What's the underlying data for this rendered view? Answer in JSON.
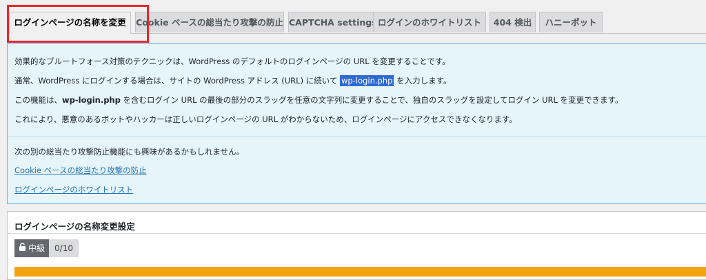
{
  "tabs": [
    {
      "label": "ログインページの名称を変更",
      "active": true
    },
    {
      "label": "Cookie ベースの総当たり攻撃の防止",
      "active": false
    },
    {
      "label": "CAPTCHA settings",
      "active": false
    },
    {
      "label": "ログインのホワイトリスト",
      "active": false
    },
    {
      "label": "404 検出",
      "active": false
    },
    {
      "label": "ハニーポット",
      "active": false
    }
  ],
  "info": {
    "line1": "効果的なブルートフォース対策のテクニックは、WordPress のデフォルトのログインページの URL を変更することです。",
    "line2_pre": "通常、WordPress にログインする場合は、サイトの WordPress アドレス (URL) に続いて ",
    "line2_hl": "wp-login.php",
    "line2_post": " を入力します。",
    "line3_pre": "この機能は、",
    "line3_bold": "wp-login.php",
    "line3_post": " を含むログイン URL の最後の部分のスラッグを任意の文字列に変更することで、独自のスラッグを設定してログイン URL を変更できます。",
    "line4": "これにより、悪意のあるボットやハッカーは正しいログインページの URL がわからないため、ログインページにアクセスできなくなります。",
    "interest": "次の別の総当たり攻撃防止機能にも興味があるかもしれません。",
    "link1": "Cookie ベースの総当たり攻撃の防止",
    "link2": "ログインページのホワイトリスト"
  },
  "panel": {
    "title": "ログインページの名称変更設定",
    "level": "中級",
    "score": "0/10"
  },
  "colors": {
    "highlight": "#e8262b",
    "info_bg": "#e5f5fa",
    "warning": "#f0a30f"
  }
}
